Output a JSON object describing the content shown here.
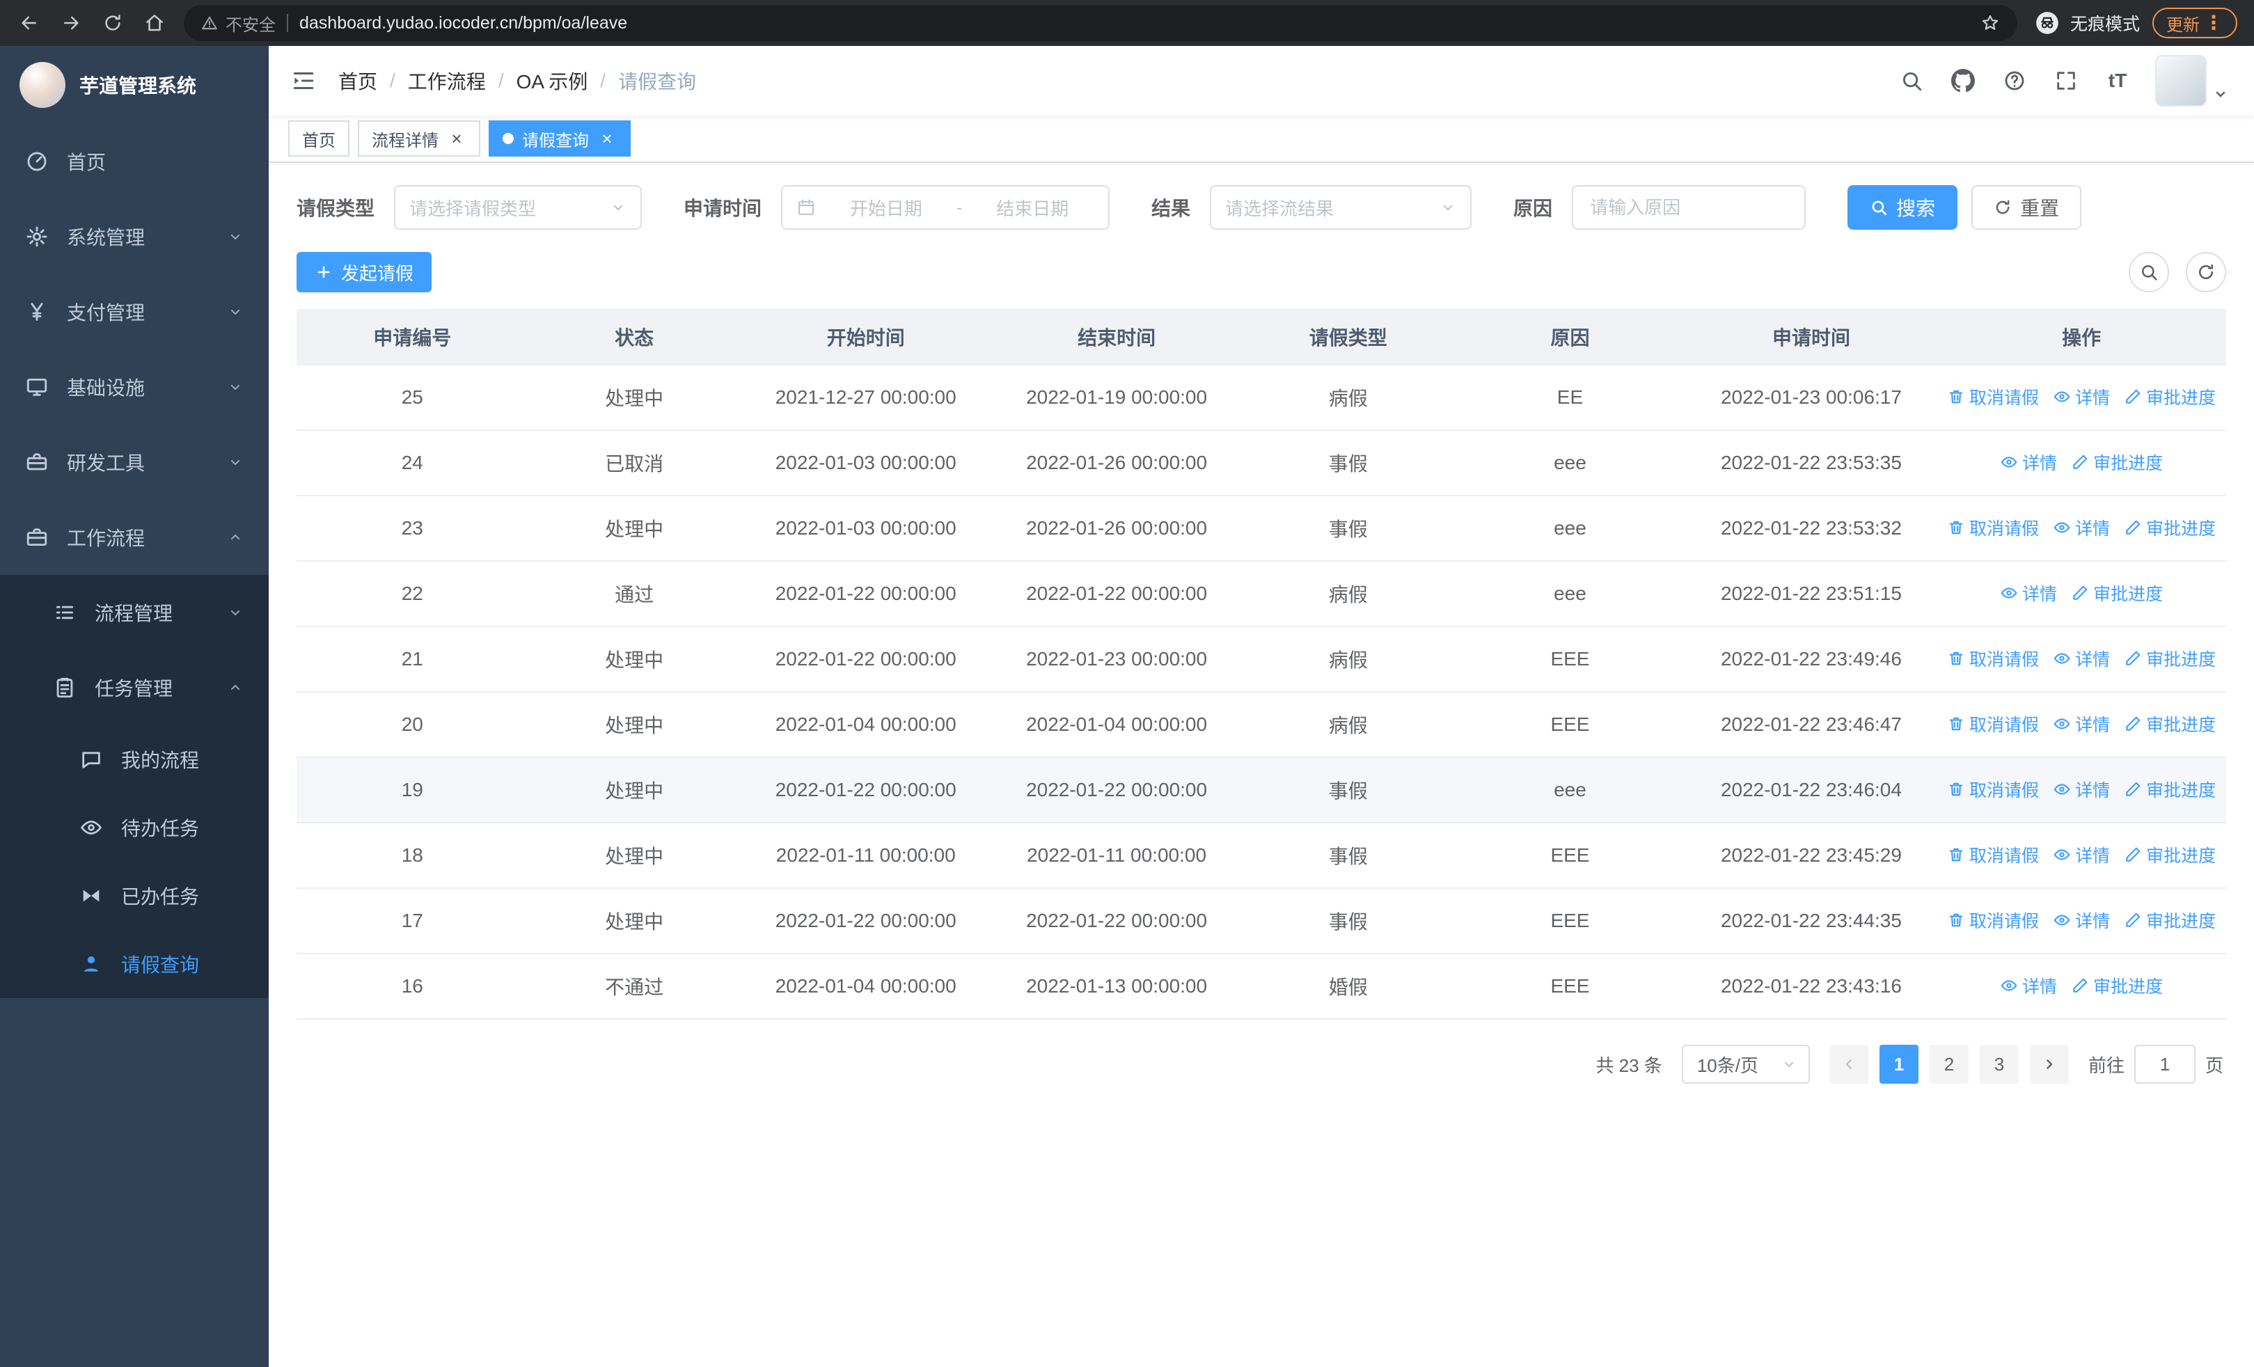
{
  "theme": {
    "accent": "#409eff",
    "sidebar_bg": "#304156",
    "submenu_bg": "#1f2d3d",
    "sidebar_text": "#bfcbd9",
    "update_orange": "#f0944d",
    "browser_bar_bg": "#2b2c2f",
    "address_bar_bg": "#1d1e21"
  },
  "browser": {
    "security_warning": "不安全",
    "url": "dashboard.yudao.iocoder.cn/bpm/oa/leave",
    "incognito_label": "无痕模式",
    "update_label": "更新"
  },
  "sidebar": {
    "logo_title": "芋道管理系统",
    "items": [
      {
        "id": "home",
        "label": "首页",
        "icon": "dashboard-icon",
        "level": 1
      },
      {
        "id": "system",
        "label": "系统管理",
        "icon": "gear-icon",
        "level": 1,
        "chevron": "down"
      },
      {
        "id": "payment",
        "label": "支付管理",
        "icon": "yen-icon",
        "level": 1,
        "chevron": "down"
      },
      {
        "id": "infra",
        "label": "基础设施",
        "icon": "monitor-icon",
        "level": 1,
        "chevron": "down"
      },
      {
        "id": "devtools",
        "label": "研发工具",
        "icon": "toolbox-icon",
        "level": 1,
        "chevron": "down"
      },
      {
        "id": "workflow",
        "label": "工作流程",
        "icon": "briefcase-icon",
        "level": 1,
        "chevron": "up"
      },
      {
        "id": "process-mgmt",
        "label": "流程管理",
        "icon": "list-icon",
        "level": 2,
        "chevron": "down"
      },
      {
        "id": "task-mgmt",
        "label": "任务管理",
        "icon": "clipboard-icon",
        "level": 2,
        "chevron": "up"
      },
      {
        "id": "my-process",
        "label": "我的流程",
        "icon": "chat-bubble-icon",
        "level": 3
      },
      {
        "id": "todo-tasks",
        "label": "待办任务",
        "icon": "eye-icon",
        "level": 3
      },
      {
        "id": "done-tasks",
        "label": "已办任务",
        "icon": "bowtie-icon",
        "level": 3
      },
      {
        "id": "leave-query",
        "label": "请假查询",
        "icon": "user-icon",
        "level": 3,
        "active": true
      }
    ]
  },
  "header": {
    "breadcrumb": {
      "items": [
        "首页",
        "工作流程",
        "OA 示例",
        "请假查询"
      ],
      "separator": "/"
    }
  },
  "tabs": [
    {
      "id": "home",
      "label": "首页",
      "closable": false,
      "active": false
    },
    {
      "id": "process-detail",
      "label": "流程详情",
      "closable": true,
      "active": false
    },
    {
      "id": "leave-query",
      "label": "请假查询",
      "closable": true,
      "active": true
    }
  ],
  "filters": {
    "leave_type_label": "请假类型",
    "leave_type_placeholder": "请选择请假类型",
    "apply_time_label": "申请时间",
    "start_date_placeholder": "开始日期",
    "range_separator": "-",
    "end_date_placeholder": "结束日期",
    "result_label": "结果",
    "result_placeholder": "请选择流结果",
    "reason_label": "原因",
    "reason_placeholder": "请输入原因",
    "search_button": "搜索",
    "reset_button": "重置"
  },
  "toolbar": {
    "create_button": "发起请假"
  },
  "table": {
    "columns": [
      {
        "key": "id",
        "label": "申请编号"
      },
      {
        "key": "status",
        "label": "状态"
      },
      {
        "key": "start",
        "label": "开始时间"
      },
      {
        "key": "end",
        "label": "结束时间"
      },
      {
        "key": "type",
        "label": "请假类型"
      },
      {
        "key": "reason",
        "label": "原因"
      },
      {
        "key": "applied",
        "label": "申请时间"
      },
      {
        "key": "actions",
        "label": "操作"
      }
    ],
    "action_labels": {
      "cancel": "取消请假",
      "detail": "详情",
      "progress": "审批进度"
    },
    "rows": [
      {
        "id": "25",
        "status": "处理中",
        "start": "2021-12-27 00:00:00",
        "end": "2022-01-19 00:00:00",
        "type": "病假",
        "reason": "EE",
        "applied": "2022-01-23 00:06:17",
        "actions": [
          "cancel",
          "detail",
          "progress"
        ],
        "highlight": false
      },
      {
        "id": "24",
        "status": "已取消",
        "start": "2022-01-03 00:00:00",
        "end": "2022-01-26 00:00:00",
        "type": "事假",
        "reason": "eee",
        "applied": "2022-01-22 23:53:35",
        "actions": [
          "detail",
          "progress"
        ],
        "highlight": false
      },
      {
        "id": "23",
        "status": "处理中",
        "start": "2022-01-03 00:00:00",
        "end": "2022-01-26 00:00:00",
        "type": "事假",
        "reason": "eee",
        "applied": "2022-01-22 23:53:32",
        "actions": [
          "cancel",
          "detail",
          "progress"
        ],
        "highlight": false
      },
      {
        "id": "22",
        "status": "通过",
        "start": "2022-01-22 00:00:00",
        "end": "2022-01-22 00:00:00",
        "type": "病假",
        "reason": "eee",
        "applied": "2022-01-22 23:51:15",
        "actions": [
          "detail",
          "progress"
        ],
        "highlight": false
      },
      {
        "id": "21",
        "status": "处理中",
        "start": "2022-01-22 00:00:00",
        "end": "2022-01-23 00:00:00",
        "type": "病假",
        "reason": "EEE",
        "applied": "2022-01-22 23:49:46",
        "actions": [
          "cancel",
          "detail",
          "progress"
        ],
        "highlight": false
      },
      {
        "id": "20",
        "status": "处理中",
        "start": "2022-01-04 00:00:00",
        "end": "2022-01-04 00:00:00",
        "type": "病假",
        "reason": "EEE",
        "applied": "2022-01-22 23:46:47",
        "actions": [
          "cancel",
          "detail",
          "progress"
        ],
        "highlight": false
      },
      {
        "id": "19",
        "status": "处理中",
        "start": "2022-01-22 00:00:00",
        "end": "2022-01-22 00:00:00",
        "type": "事假",
        "reason": "eee",
        "applied": "2022-01-22 23:46:04",
        "actions": [
          "cancel",
          "detail",
          "progress"
        ],
        "highlight": true
      },
      {
        "id": "18",
        "status": "处理中",
        "start": "2022-01-11 00:00:00",
        "end": "2022-01-11 00:00:00",
        "type": "事假",
        "reason": "EEE",
        "applied": "2022-01-22 23:45:29",
        "actions": [
          "cancel",
          "detail",
          "progress"
        ],
        "highlight": false
      },
      {
        "id": "17",
        "status": "处理中",
        "start": "2022-01-22 00:00:00",
        "end": "2022-01-22 00:00:00",
        "type": "事假",
        "reason": "EEE",
        "applied": "2022-01-22 23:44:35",
        "actions": [
          "cancel",
          "detail",
          "progress"
        ],
        "highlight": false
      },
      {
        "id": "16",
        "status": "不通过",
        "start": "2022-01-04 00:00:00",
        "end": "2022-01-13 00:00:00",
        "type": "婚假",
        "reason": "EEE",
        "applied": "2022-01-22 23:43:16",
        "actions": [
          "detail",
          "progress"
        ],
        "highlight": false
      }
    ]
  },
  "pagination": {
    "total_text": "共 23 条",
    "page_size": "10条/页",
    "pages": [
      "1",
      "2",
      "3"
    ],
    "active_page": "1",
    "goto_label": "前往",
    "goto_value": "1",
    "goto_suffix": "页"
  }
}
